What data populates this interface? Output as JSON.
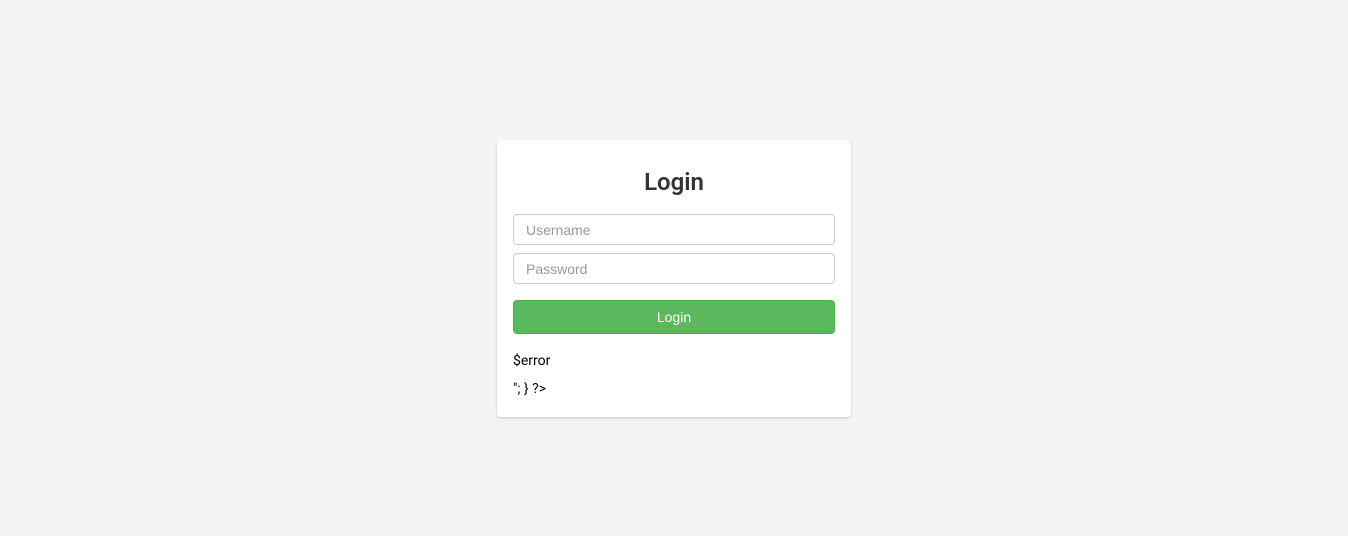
{
  "card": {
    "title": "Login",
    "username_placeholder": "Username",
    "password_placeholder": "Password",
    "button_label": "Login",
    "error_text": "$error",
    "trailing_text": "\"; } ?>"
  }
}
